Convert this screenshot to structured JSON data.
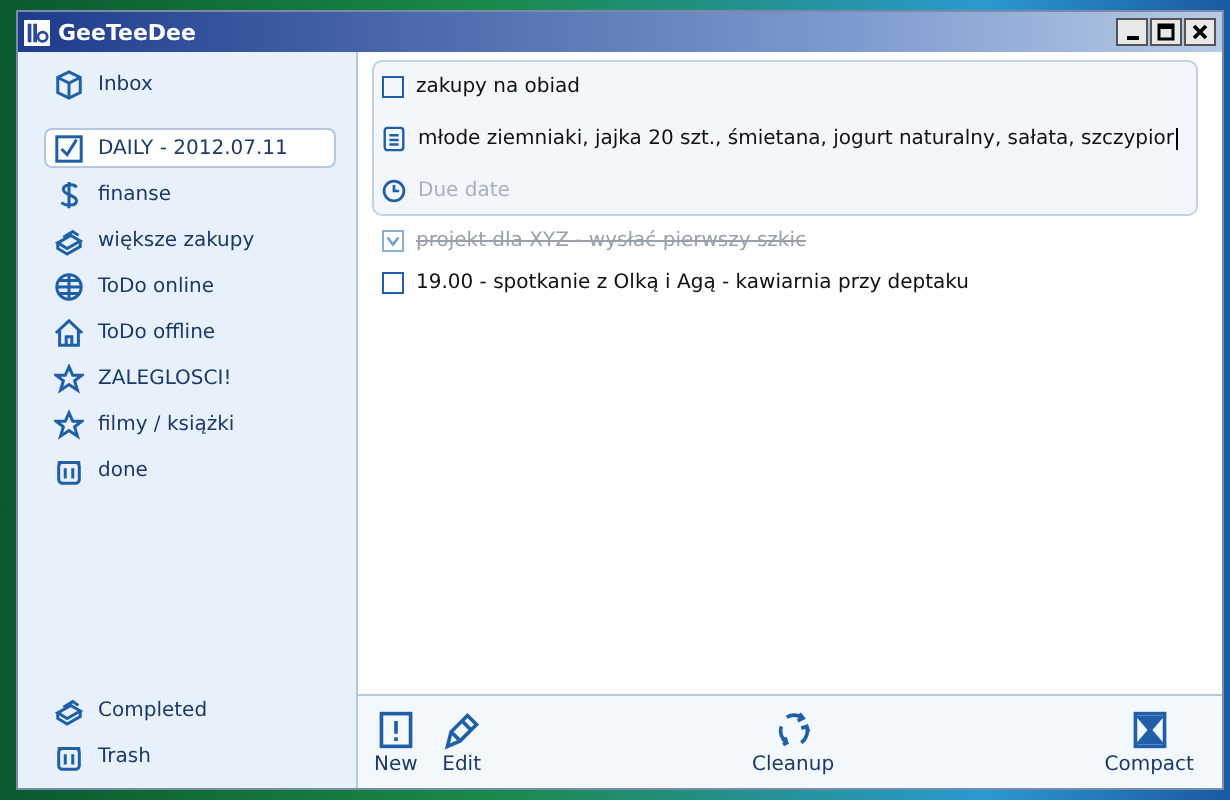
{
  "window": {
    "title": "GeeTeeDee"
  },
  "sidebar": {
    "items": [
      {
        "label": "Inbox",
        "kind": "box",
        "selected": false
      },
      {
        "label": "DAILY - 2012.07.11",
        "kind": "check",
        "selected": true
      },
      {
        "label": "finanse",
        "kind": "dollar",
        "selected": false
      },
      {
        "label": "większe zakupy",
        "kind": "stack",
        "selected": false
      },
      {
        "label": "ToDo online",
        "kind": "globe",
        "selected": false
      },
      {
        "label": "ToDo offline",
        "kind": "home",
        "selected": false
      },
      {
        "label": "ZALEGLOSCI!",
        "kind": "star",
        "selected": false
      },
      {
        "label": "filmy / książki",
        "kind": "star",
        "selected": false
      },
      {
        "label": "done",
        "kind": "trash",
        "selected": false
      }
    ],
    "bottom_items": [
      {
        "label": "Completed",
        "kind": "stack",
        "selected": false
      },
      {
        "label": "Trash",
        "kind": "trash",
        "selected": false
      }
    ]
  },
  "tasks": [
    {
      "title": "zakupy na obiad",
      "checked": false,
      "expanded": true,
      "note": "młode ziemniaki, jajka 20 szt., śmietana, jogurt naturalny, sałata, szczypior",
      "due_placeholder": "Due date"
    },
    {
      "title": "projekt dla XYZ - wysłać pierwszy szkic",
      "checked": true,
      "expanded": false
    },
    {
      "title": "19.00 - spotkanie z Olką i Agą - kawiarnia przy deptaku",
      "checked": false,
      "expanded": false
    }
  ],
  "toolbar": [
    {
      "label": "New",
      "kind": "new"
    },
    {
      "label": "Edit",
      "kind": "edit"
    },
    {
      "label": "Cleanup",
      "kind": "cleanup"
    },
    {
      "label": "Compact",
      "kind": "compact"
    }
  ]
}
